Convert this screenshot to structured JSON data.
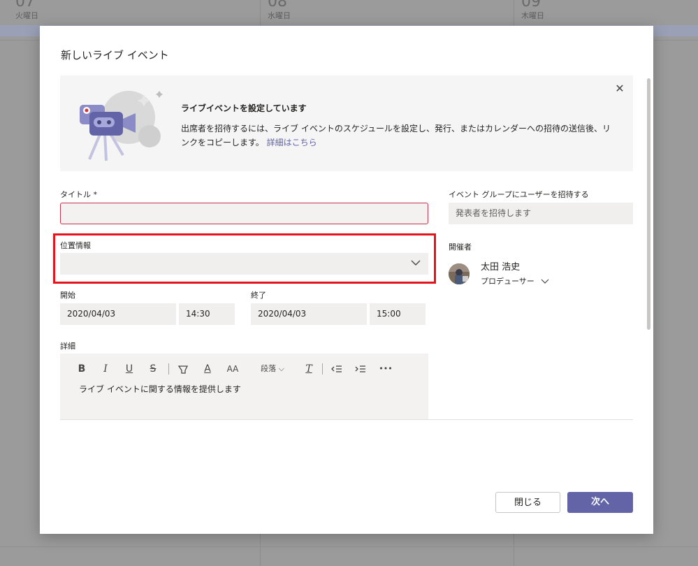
{
  "background": {
    "days": [
      {
        "num": "07",
        "label": "火曜日"
      },
      {
        "num": "08",
        "label": "水曜日"
      },
      {
        "num": "09",
        "label": "木曜日"
      }
    ]
  },
  "dialog": {
    "title": "新しいライブ イベント",
    "banner": {
      "heading": "ライブイベントを設定しています",
      "body": "出席者を招待するには、ライブ イベントのスケジュールを設定し、発行、またはカレンダーへの招待の送信後、リンクをコピーします。",
      "link": "詳細はこちら"
    },
    "title_field": {
      "label": "タイトル *",
      "value": ""
    },
    "location_field": {
      "label": "位置情報",
      "value": ""
    },
    "start": {
      "label": "開始",
      "date": "2020/04/03",
      "time": "14:30"
    },
    "end": {
      "label": "終了",
      "date": "2020/04/03",
      "time": "15:00"
    },
    "details": {
      "label": "詳細",
      "placeholder": "ライブ イベントに関する情報を提供します",
      "toolbar": {
        "bold": "B",
        "italic": "I",
        "underline": "U",
        "strike": "S",
        "font_color": "A",
        "font_size": "AA",
        "paragraph": "段落",
        "clear_format": "T",
        "more": "•••"
      }
    },
    "invite": {
      "label": "イベント グループにユーザーを招待する",
      "placeholder": "発表者を招待します"
    },
    "organizer": {
      "label": "開催者",
      "name": "太田 浩史",
      "role": "プロデューサー"
    },
    "buttons": {
      "close": "閉じる",
      "next": "次へ"
    }
  },
  "colors": {
    "accent": "#6264a7",
    "error": "#c4314b",
    "highlight": "#e3141c"
  }
}
